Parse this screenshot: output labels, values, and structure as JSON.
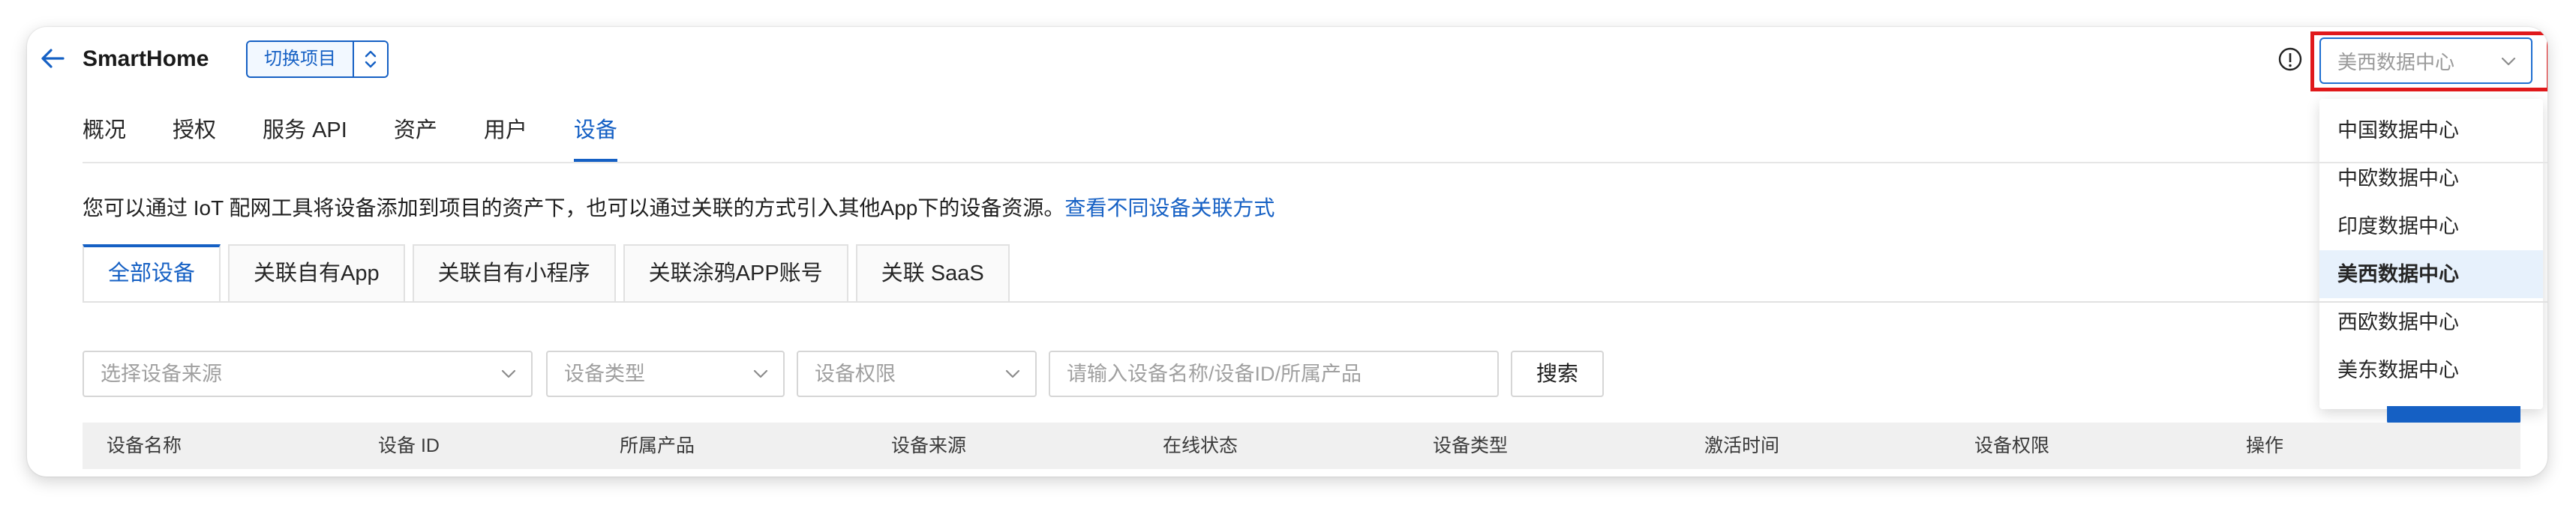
{
  "header": {
    "title": "SmartHome",
    "switch_label": "切换项目"
  },
  "region": {
    "selected": "美西数据中心",
    "options": [
      "中国数据中心",
      "中欧数据中心",
      "印度数据中心",
      "美西数据中心",
      "西欧数据中心",
      "美东数据中心"
    ],
    "active_index": 3
  },
  "nav": {
    "items": [
      "概况",
      "授权",
      "服务 API",
      "资产",
      "用户",
      "设备"
    ],
    "active_index": 5
  },
  "description": {
    "text": "您可以通过 IoT 配网工具将设备添加到项目的资产下，也可以通过关联的方式引入其他App下的设备资源。",
    "link": "查看不同设备关联方式"
  },
  "subtabs": {
    "items": [
      "全部设备",
      "关联自有App",
      "关联自有小程序",
      "关联涂鸦APP账号",
      "关联 SaaS"
    ],
    "active_index": 0
  },
  "filters": {
    "source_placeholder": "选择设备来源",
    "type_placeholder": "设备类型",
    "permission_placeholder": "设备权限",
    "search_placeholder": "请输入设备名称/设备ID/所属产品",
    "search_button": "搜索"
  },
  "table": {
    "columns": [
      "设备名称",
      "设备 ID",
      "所属产品",
      "设备来源",
      "在线状态",
      "设备类型",
      "激活时间",
      "设备权限",
      "操作"
    ]
  },
  "colors": {
    "accent": "#1560c4",
    "highlight_frame": "#e0191b",
    "active_option_bg": "#e7f1fc"
  }
}
